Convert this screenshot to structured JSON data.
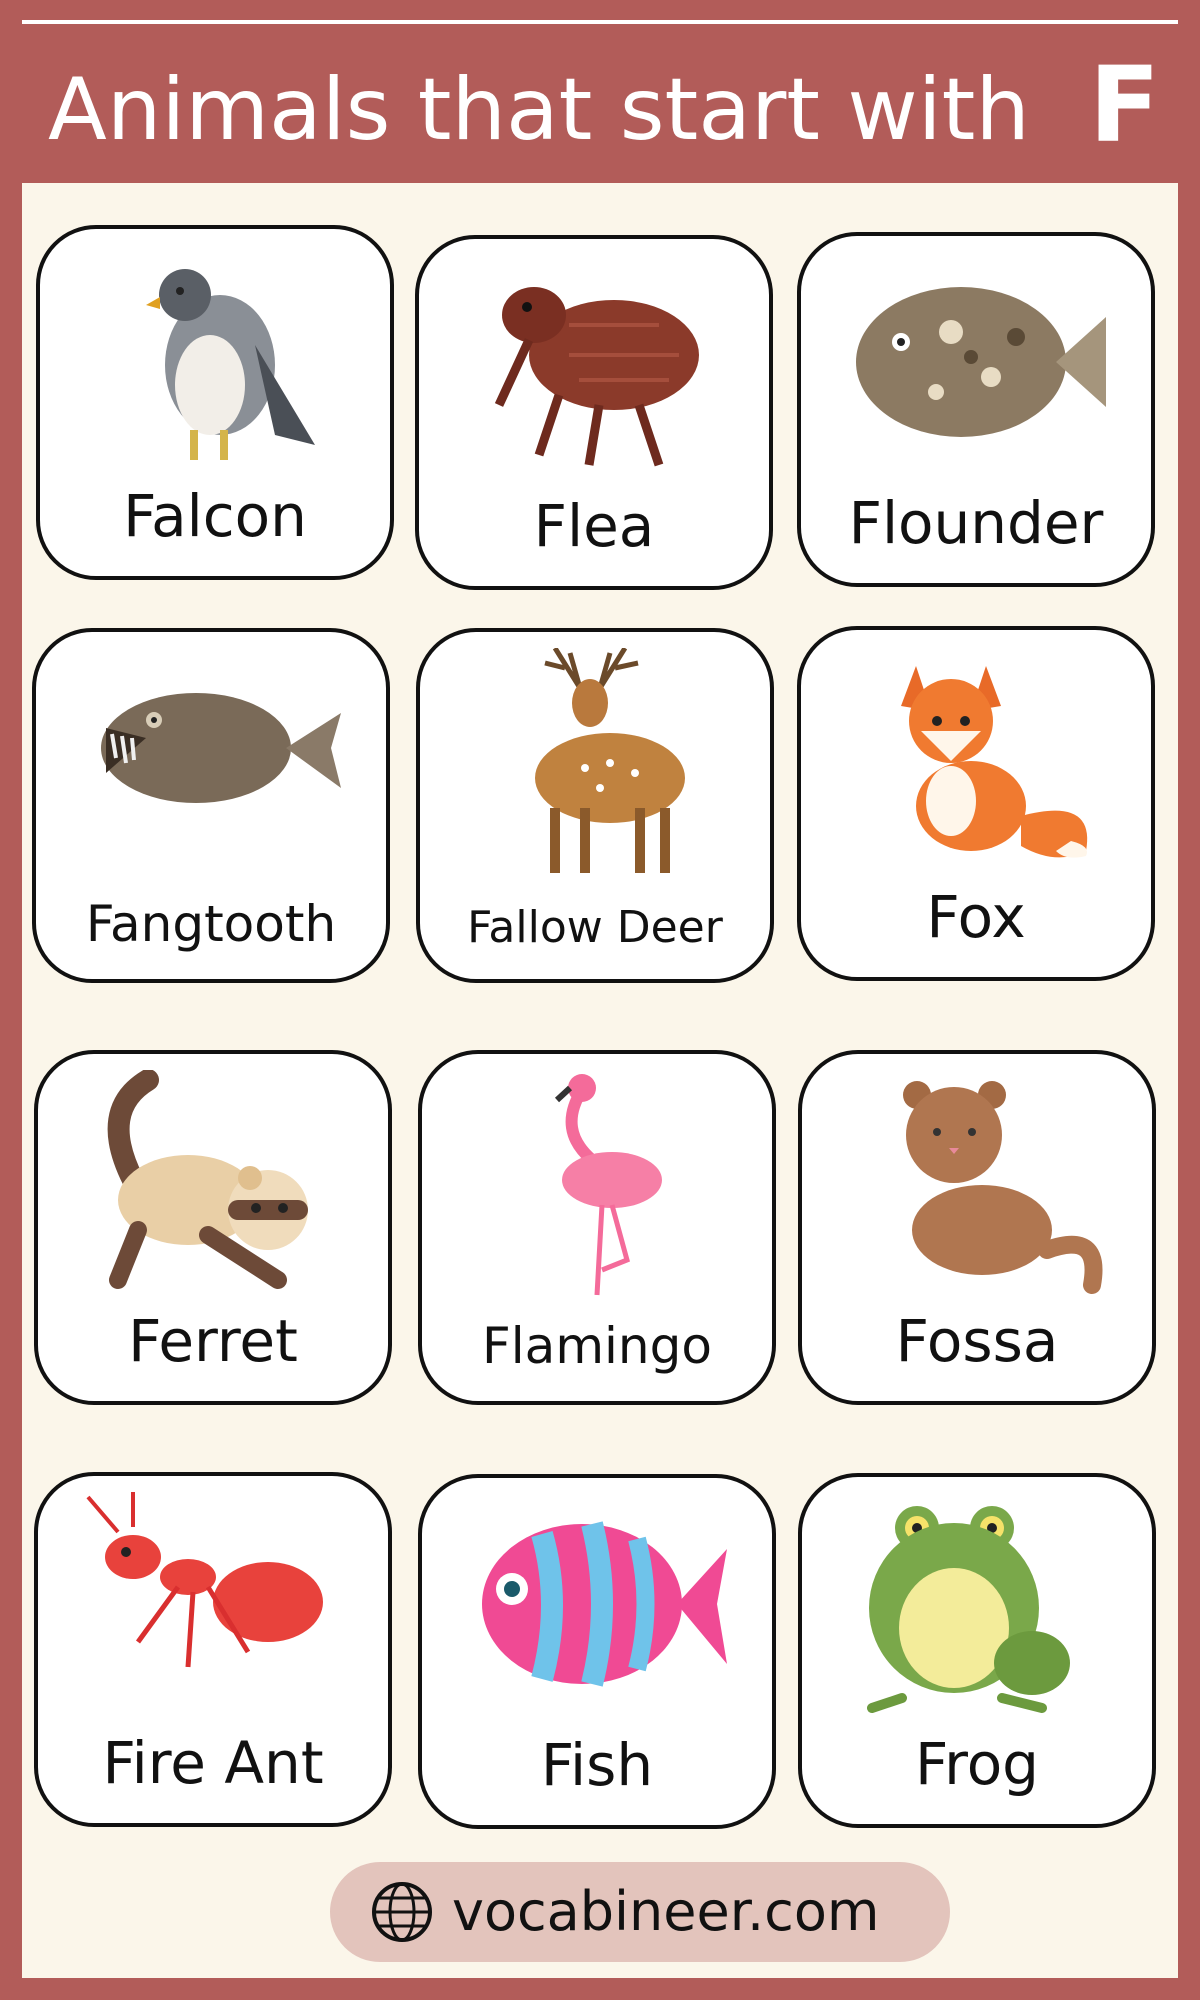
{
  "header": {
    "title": "Animals that start with",
    "letter": "F"
  },
  "cards": [
    {
      "label": "Falcon",
      "icon": "falcon-icon"
    },
    {
      "label": "Flea",
      "icon": "flea-icon"
    },
    {
      "label": "Flounder",
      "icon": "flounder-icon"
    },
    {
      "label": "Fangtooth",
      "icon": "fangtooth-icon"
    },
    {
      "label": "Fallow Deer",
      "icon": "fallow-deer-icon"
    },
    {
      "label": "Fox",
      "icon": "fox-icon"
    },
    {
      "label": "Ferret",
      "icon": "ferret-icon"
    },
    {
      "label": "Flamingo",
      "icon": "flamingo-icon"
    },
    {
      "label": "Fossa",
      "icon": "fossa-icon"
    },
    {
      "label": "Fire Ant",
      "icon": "fire-ant-icon"
    },
    {
      "label": "Fish",
      "icon": "fish-icon"
    },
    {
      "label": "Frog",
      "icon": "frog-icon"
    }
  ],
  "footer": {
    "site": "vocabineer.com",
    "icon": "globe-icon"
  },
  "colors": {
    "frame": "#b25c59",
    "panel": "#fbf6ea",
    "pill": "#e3c4bc"
  }
}
